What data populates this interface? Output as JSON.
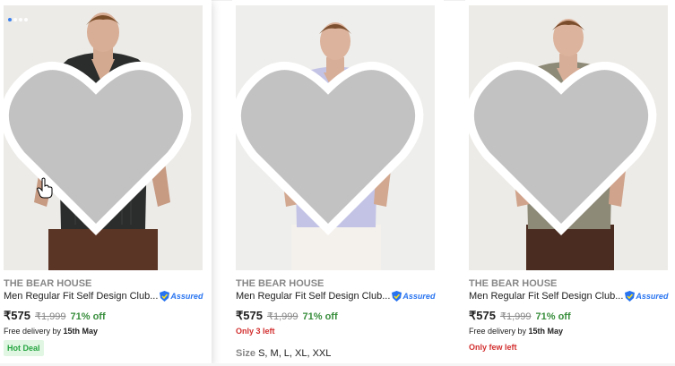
{
  "products": [
    {
      "brand": "THE BEAR HOUSE",
      "title": "Men Regular Fit Self Design Club...",
      "assured": "Assured",
      "price": "₹575",
      "mrp": "₹1,999",
      "discount": "71% off",
      "delivery_prefix": "Free delivery by ",
      "delivery_date": "15th May",
      "badge": "Hot Deal",
      "shirt_color": "#2b2d2c"
    },
    {
      "brand": "THE BEAR HOUSE",
      "title": "Men Regular Fit Self Design Club...",
      "assured": "Assured",
      "price": "₹575",
      "mrp": "₹1,999",
      "discount": "71% off",
      "stock_note": "Only 3 left",
      "sizes_label": "Size",
      "sizes": "S, M, L, XL, XXL",
      "shirt_color": "#c3c3e6"
    },
    {
      "brand": "THE BEAR HOUSE",
      "title": "Men Regular Fit Self Design Club...",
      "assured": "Assured",
      "price": "₹575",
      "mrp": "₹1,999",
      "discount": "71% off",
      "delivery_prefix": "Free delivery by ",
      "delivery_date": "15th May",
      "stock_note": "Only few left",
      "shirt_color": "#8e8a78"
    }
  ],
  "colors": {
    "accent": "#2874f0",
    "discount_green": "#388e3c",
    "stock_red": "#d32f2f",
    "brand_grey": "#878787"
  }
}
